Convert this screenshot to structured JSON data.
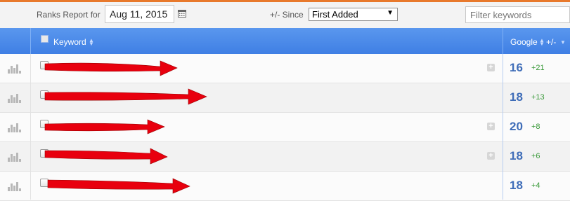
{
  "toolbar": {
    "ranks_report_label": "Ranks Report for",
    "date_value": "Aug 11, 2015",
    "since_label": "+/- Since",
    "since_selected": "First Added",
    "filter_placeholder": "Filter keywords"
  },
  "table": {
    "headers": {
      "keyword": "Keyword",
      "google": "Google",
      "change": "+/-"
    },
    "rows": [
      {
        "rank": "16",
        "delta": "+21",
        "expandable": true
      },
      {
        "rank": "18",
        "delta": "+13",
        "expandable": false
      },
      {
        "rank": "20",
        "delta": "+8",
        "expandable": true
      },
      {
        "rank": "18",
        "delta": "+6",
        "expandable": true
      },
      {
        "rank": "18",
        "delta": "+4",
        "expandable": false
      }
    ]
  },
  "colors": {
    "header_blue": "#4a8ae9",
    "rank_blue": "#3f6db8",
    "delta_green": "#3a9a3a",
    "redaction_red": "#e8000e",
    "accent_orange": "#e8792c"
  }
}
